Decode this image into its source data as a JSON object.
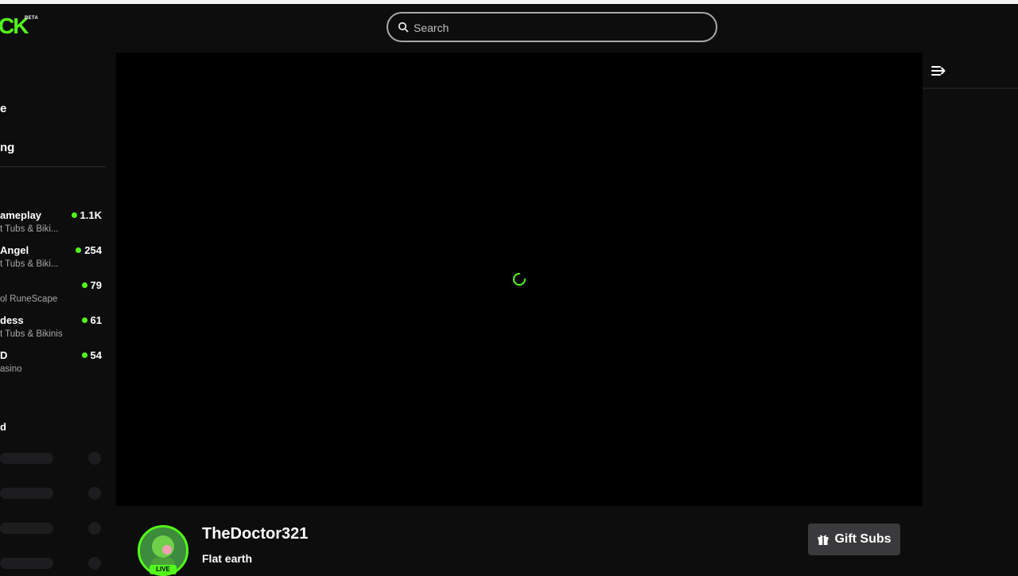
{
  "brand": {
    "logo_text": "CK",
    "beta": "BETA"
  },
  "search": {
    "placeholder": "Search"
  },
  "nav": {
    "home_fragment": "e",
    "following_fragment": "ng"
  },
  "channels": [
    {
      "name": "ameplay",
      "category": "t Tubs & Biki...",
      "viewers": "1.1K"
    },
    {
      "name": "Angel",
      "category": "t Tubs & Biki...",
      "viewers": "254"
    },
    {
      "name": "",
      "category": "ol RuneScape",
      "viewers": "79"
    },
    {
      "name": "dess",
      "category": "t Tubs & Bikinis",
      "viewers": "61"
    },
    {
      "name": "D",
      "category": "asino",
      "viewers": "54"
    }
  ],
  "recommended_label_fragment": "d",
  "stream": {
    "streamer": "TheDoctor321",
    "title": "Flat earth",
    "live_label": "LIVE",
    "gift_label": "Gift Subs"
  },
  "colors": {
    "accent": "#53fc18",
    "background": "#0d0d0e",
    "player": "#000000",
    "button": "#3a3a3c"
  },
  "icons": [
    "search-icon",
    "collapse-chat-icon",
    "gift-icon",
    "loading-spinner-icon"
  ]
}
